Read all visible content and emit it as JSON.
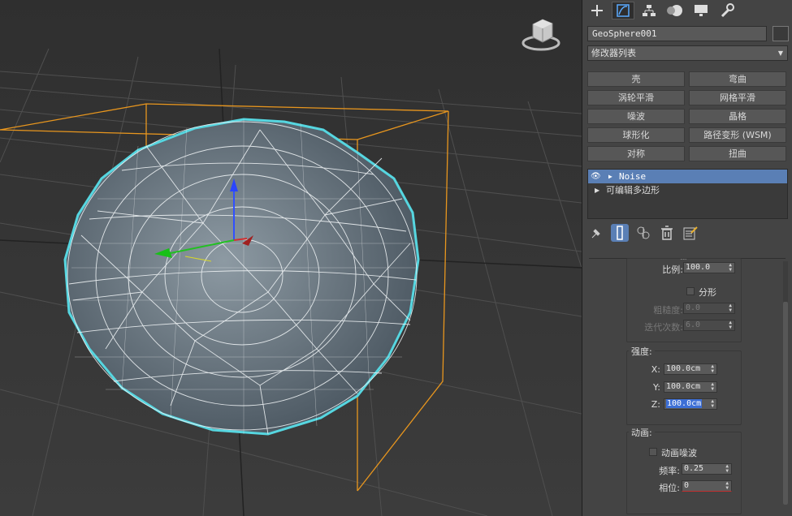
{
  "object": {
    "name": "GeoSphere001"
  },
  "modifier_list": {
    "label": "修改器列表"
  },
  "modifier_buttons": [
    "壳",
    "弯曲",
    "涡轮平滑",
    "网格平滑",
    "噪波",
    "晶格",
    "球形化",
    "路径变形 (WSM)",
    "对称",
    "扭曲"
  ],
  "stack": [
    {
      "label": "Noise",
      "selected": true
    },
    {
      "label": "可编辑多边形",
      "selected": false
    }
  ],
  "params": {
    "scale_label": "比例:",
    "scale_value": "100.0",
    "fractal_label": "分形",
    "roughness_label": "粗糙度:",
    "roughness_value": "0.0",
    "iterations_label": "迭代次数:",
    "iterations_value": "6.0",
    "strength_title": "强度:",
    "x_label": "X:",
    "x_value": "100.0cm",
    "y_label": "Y:",
    "y_value": "100.0cm",
    "z_label": "Z:",
    "z_value": "100.0cm",
    "anim_title": "动画:",
    "anim_noise_label": "动画噪波",
    "freq_label": "频率:",
    "freq_value": "0.25",
    "phase_label": "相位:",
    "phase_value": "0"
  },
  "icons": {
    "tabs": [
      "create-icon",
      "modify-icon",
      "hierarchy-icon",
      "motion-icon",
      "display-icon",
      "utilities-icon"
    ],
    "stack_tools": [
      "pin-stack-icon",
      "show-end-result-icon",
      "make-unique-icon",
      "remove-modifier-icon",
      "configure-sets-icon"
    ]
  },
  "colors": {
    "selection": "#5a7fb5",
    "bounding_box": "#e8961e",
    "wireframe": "#ffffff",
    "highlight": "#56d6e0"
  }
}
